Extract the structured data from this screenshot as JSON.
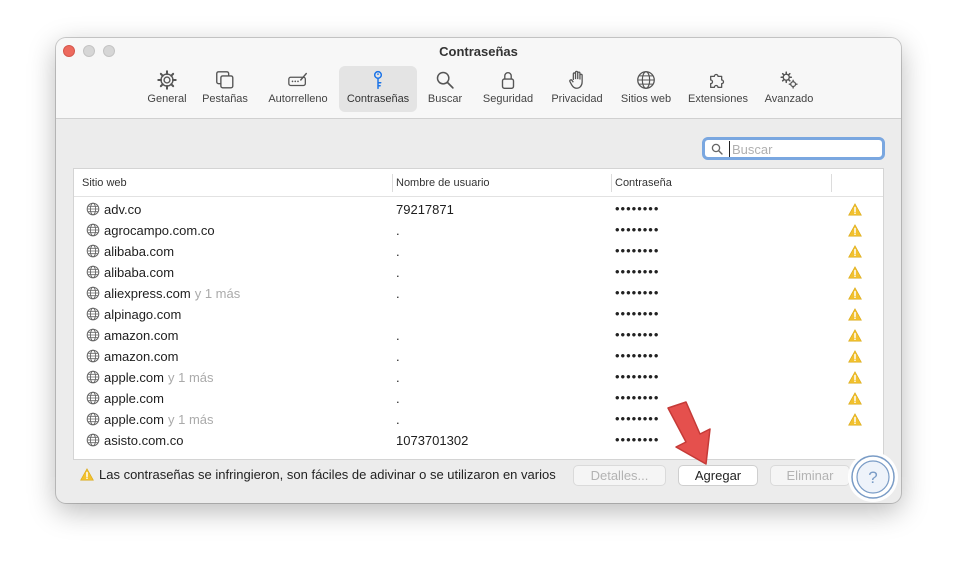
{
  "window": {
    "title": "Contraseñas"
  },
  "toolbar": {
    "items": [
      {
        "label": "General",
        "icon": "gear-icon"
      },
      {
        "label": "Pestañas",
        "icon": "tabs-icon"
      },
      {
        "label": "Autorrelleno",
        "icon": "pencil-field-icon"
      },
      {
        "label": "Contraseñas",
        "icon": "key-icon",
        "active": true
      },
      {
        "label": "Buscar",
        "icon": "magnifier-icon"
      },
      {
        "label": "Seguridad",
        "icon": "lock-icon"
      },
      {
        "label": "Privacidad",
        "icon": "hand-icon"
      },
      {
        "label": "Sitios web",
        "icon": "globe-icon"
      },
      {
        "label": "Extensiones",
        "icon": "puzzle-icon"
      },
      {
        "label": "Avanzado",
        "icon": "gears-icon"
      }
    ]
  },
  "search": {
    "placeholder": "Buscar",
    "value": ""
  },
  "table": {
    "headers": {
      "site": "Sitio web",
      "user": "Nombre de usuario",
      "password": "Contraseña"
    },
    "rows": [
      {
        "site": "adv.co",
        "more": "",
        "user": "79217871",
        "password": "••••••••",
        "warning": true
      },
      {
        "site": "agrocampo.com.co",
        "more": "",
        "user": ".",
        "password": "••••••••",
        "warning": true
      },
      {
        "site": "alibaba.com",
        "more": "",
        "user": ".",
        "password": "••••••••",
        "warning": true
      },
      {
        "site": "alibaba.com",
        "more": "",
        "user": ".",
        "password": "••••••••",
        "warning": true
      },
      {
        "site": "aliexpress.com",
        "more": "y 1 más",
        "user": ".",
        "password": "••••••••",
        "warning": true
      },
      {
        "site": "alpinago.com",
        "more": "",
        "user": "",
        "password": "••••••••",
        "warning": true
      },
      {
        "site": "amazon.com",
        "more": "",
        "user": ".",
        "password": "••••••••",
        "warning": true
      },
      {
        "site": "amazon.com",
        "more": "",
        "user": ".",
        "password": "••••••••",
        "warning": true
      },
      {
        "site": "apple.com",
        "more": "y 1 más",
        "user": ".",
        "password": "••••••••",
        "warning": true
      },
      {
        "site": "apple.com",
        "more": "",
        "user": ".",
        "password": "••••••••",
        "warning": true
      },
      {
        "site": "apple.com",
        "more": "y 1 más",
        "user": ".",
        "password": "••••••••",
        "warning": true
      },
      {
        "site": "asisto.com.co",
        "more": "",
        "user": "1073701302",
        "password": "••••••••",
        "warning": false
      }
    ]
  },
  "footer": {
    "message": "Las contraseñas se infringieron, son fáciles de adivinar o se utilizaron en varios",
    "details_label": "Detalles...",
    "add_label": "Agregar",
    "delete_label": "Eliminar"
  },
  "colors": {
    "accent": "#1a73e8",
    "warning": "#f2c12e",
    "arrow": "#e5504d",
    "help": "#7a9cc6"
  }
}
